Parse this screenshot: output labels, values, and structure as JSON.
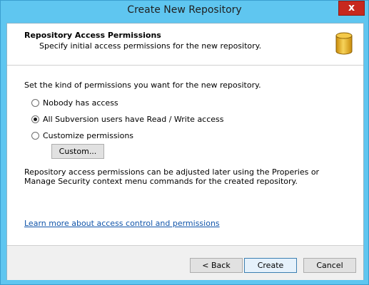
{
  "window": {
    "title": "Create New Repository",
    "close_glyph": "x"
  },
  "header": {
    "title": "Repository Access Permissions",
    "subtitle": "Specify initial access permissions for the new repository.",
    "icon": "database-icon"
  },
  "content": {
    "intro": "Set the kind of permissions you want for the new repository.",
    "options": [
      {
        "label": "Nobody has access",
        "checked": false
      },
      {
        "label": "All Subversion users have Read / Write access",
        "checked": true
      },
      {
        "label": "Customize permissions",
        "checked": false
      }
    ],
    "custom_button": "Custom...",
    "note": "Repository access permissions can be adjusted later using the Properies or Manage Security context menu commands for the created repository.",
    "learn_link": "Learn more about access control and permissions"
  },
  "footer": {
    "back_label": "< Back",
    "create_label": "Create",
    "cancel_label": "Cancel"
  },
  "colors": {
    "title_bar": "#5fc6f0",
    "close_button": "#c7281e",
    "link": "#1155aa",
    "db_gold": "#e8b21f"
  }
}
